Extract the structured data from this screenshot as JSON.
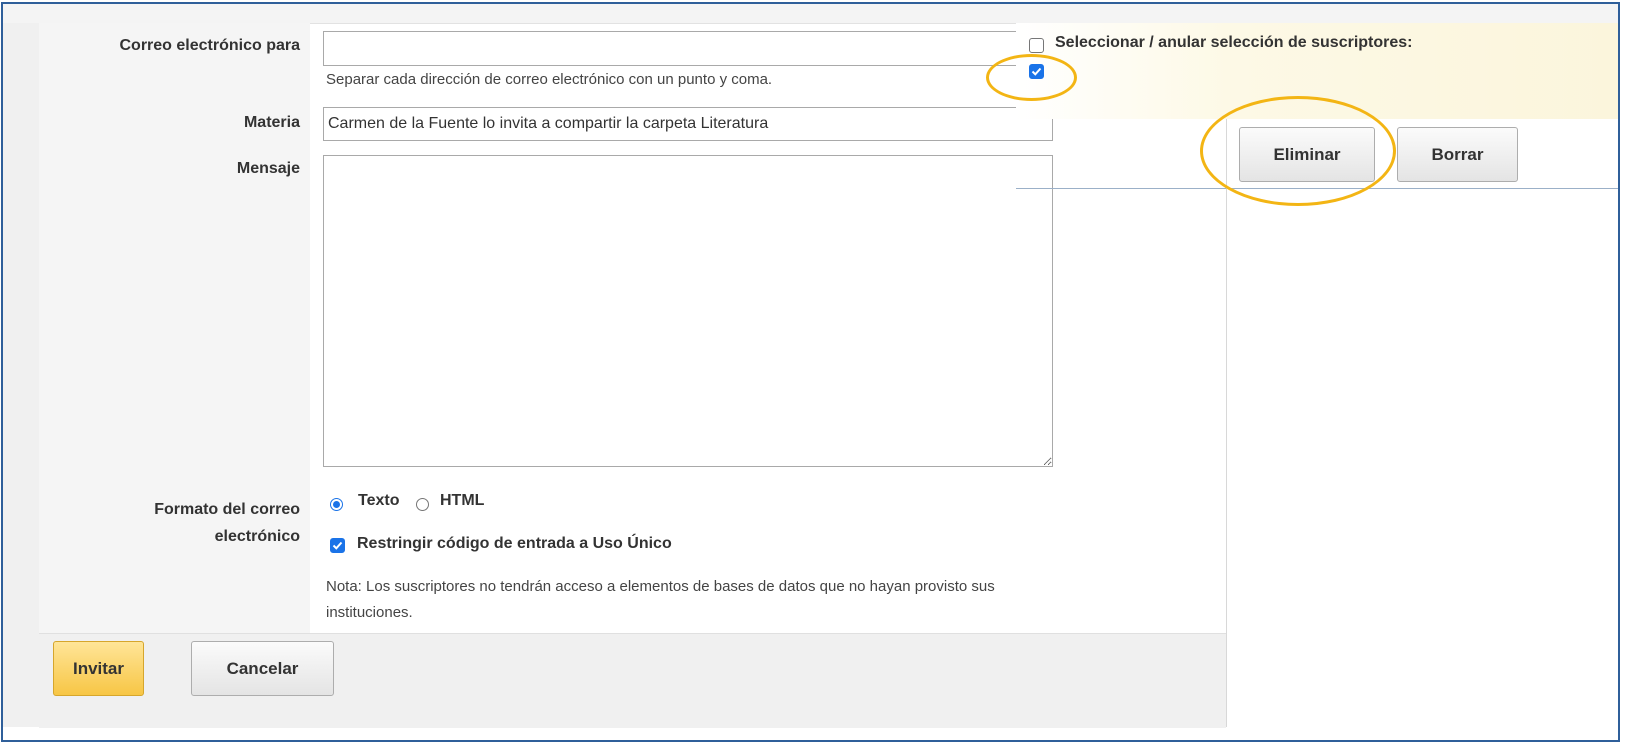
{
  "form": {
    "email_to_label": "Correo electrónico para",
    "email_to_value": "",
    "email_hint": "Separar cada dirección de correo electrónico con un punto y coma.",
    "subject_label": "Materia",
    "subject_value": "Carmen de la Fuente lo invita a compartir la carpeta Literatura",
    "message_label": "Mensaje",
    "message_value": "",
    "format_label_line1": "Formato del correo",
    "format_label_line2": "electrónico",
    "format_options": [
      "Texto",
      "HTML"
    ],
    "format_selected": "Texto",
    "restrict_label": "Restringir código de entrada a Uso Único",
    "restrict_checked": true,
    "note_line1": "Nota: Los suscriptores no tendrán acceso a elementos de bases de datos que no hayan provisto sus",
    "note_line2": "instituciones."
  },
  "footer": {
    "invite_label": "Invitar",
    "cancel_label": "Cancelar"
  },
  "subscribers": {
    "select_all_label": "Seleccionar / anular selección de suscriptores:",
    "select_all_checked": false,
    "row_checked": true,
    "delete_label": "Eliminar",
    "clear_label": "Borrar"
  },
  "colors": {
    "highlight_ring": "#f3b514",
    "primary_button": "#f7c645",
    "checkbox_blue": "#1a73e8",
    "frame_border": "#2f5f9a"
  }
}
